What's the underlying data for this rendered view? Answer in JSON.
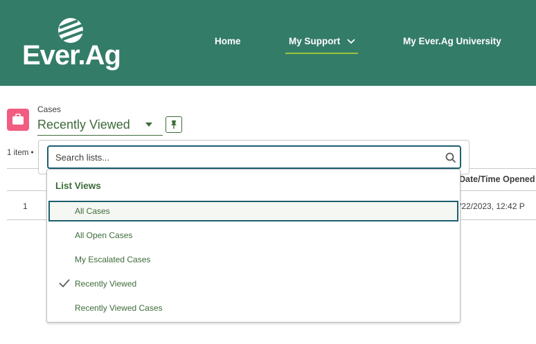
{
  "header": {
    "logo_text": "Ever.Ag",
    "nav": {
      "home": "Home",
      "support": "My Support",
      "university": "My Ever.Ag University"
    }
  },
  "object": {
    "label": "Cases",
    "list_view_selected": "Recently Viewed",
    "item_count": "1 item •"
  },
  "table": {
    "date_header": "Date/Time Opened",
    "rows": [
      {
        "num": "1",
        "date": "/22/2023, 12:42 P"
      }
    ]
  },
  "search": {
    "placeholder": "Search lists..."
  },
  "list_views": {
    "heading": "List Views",
    "items": [
      {
        "label": "All Cases"
      },
      {
        "label": "All Open Cases"
      },
      {
        "label": "My Escalated Cases"
      },
      {
        "label": "Recently Viewed"
      },
      {
        "label": "Recently Viewed Cases"
      }
    ]
  },
  "colors": {
    "header_bg": "#337C68",
    "accent_green": "#3D6B3A",
    "nav_underline": "#9BC53D",
    "cases_icon": "#F25C80",
    "focus_border": "#1B5E6E"
  }
}
